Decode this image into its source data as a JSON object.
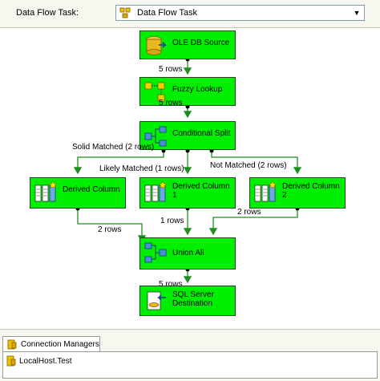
{
  "header": {
    "label": "Data Flow Task:",
    "selected_task": "Data Flow Task"
  },
  "nodes": {
    "ole_db_source": "OLE DB Source",
    "fuzzy_lookup": "Fuzzy Lookup",
    "conditional_split": "Conditional Split",
    "derived_column": "Derived Column",
    "derived_column_1": "Derived Column\n1",
    "derived_column_2": "Derived Column\n2",
    "union_all": "Union All",
    "sql_destination": "SQL Server\nDestination"
  },
  "paths": {
    "source_to_lookup": "5 rows",
    "lookup_to_split": "5 rows",
    "solid_matched": "Solid Matched (2 rows)",
    "likely_matched": "Likely Matched (1 rows)",
    "not_matched": "Not Matched (2 rows)",
    "derived_to_union": "2 rows",
    "derived1_to_union": "1 rows",
    "derived2_to_union": "2 rows",
    "union_to_destination": "5 rows"
  },
  "connection_managers": {
    "tab_label": "Connection Managers",
    "items": [
      "LocalHost.Test"
    ]
  },
  "colors": {
    "node_fill": "#00ee00",
    "path_line": "#1e8f1e"
  }
}
